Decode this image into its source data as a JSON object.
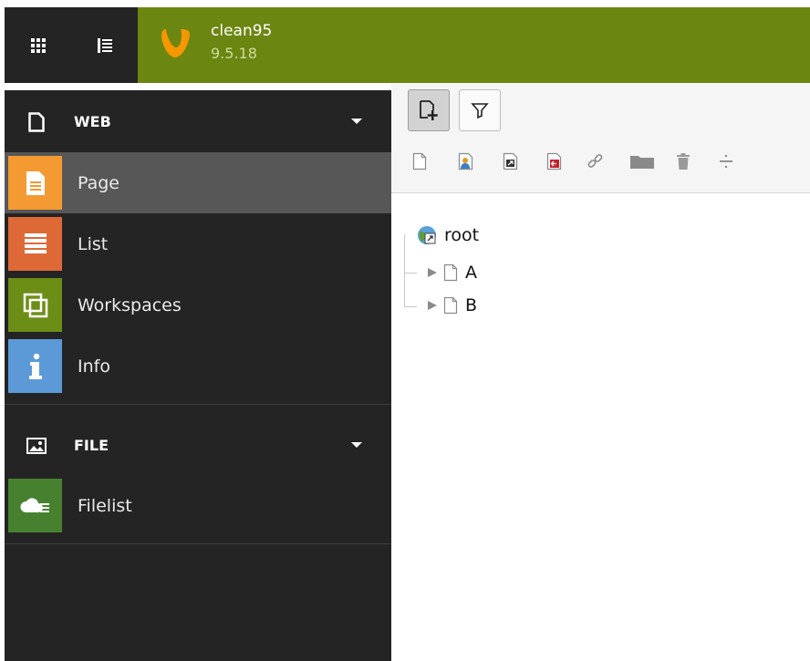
{
  "topbar": {
    "app_switcher_icon": "app-grid-icon",
    "tree_toggle_icon": "list-tree-icon",
    "site_name": "clean95",
    "version": "9.5.18",
    "brand_color": "#6b8611",
    "logo_color": "#f49700"
  },
  "sidebar": {
    "groups": [
      {
        "label": "WEB",
        "icon": "document-icon",
        "items": [
          {
            "label": "Page",
            "icon": "page-module-icon",
            "color": "#f49a33",
            "active": true
          },
          {
            "label": "List",
            "icon": "list-module-icon",
            "color": "#dd6a36",
            "active": false
          },
          {
            "label": "Workspaces",
            "icon": "workspaces-module-icon",
            "color": "#6d8e16",
            "active": false
          },
          {
            "label": "Info",
            "icon": "info-module-icon",
            "color": "#5b9ad6",
            "active": false
          }
        ]
      },
      {
        "label": "FILE",
        "icon": "image-icon",
        "items": [
          {
            "label": "Filelist",
            "icon": "filelist-module-icon",
            "color": "#47812f",
            "active": false
          }
        ]
      }
    ]
  },
  "toolbar": {
    "buttons": [
      {
        "icon": "new-page-icon",
        "active": true
      },
      {
        "icon": "filter-icon",
        "active": false
      }
    ],
    "drag_items": [
      {
        "icon": "page-default-icon"
      },
      {
        "icon": "page-backend-user-icon"
      },
      {
        "icon": "page-shortcut-icon"
      },
      {
        "icon": "page-external-link-icon"
      },
      {
        "icon": "page-link-icon"
      },
      {
        "icon": "folder-icon"
      },
      {
        "icon": "recycler-icon"
      },
      {
        "icon": "menu-separator-icon"
      }
    ]
  },
  "tree": {
    "root": {
      "label": "root",
      "icon": "globe-site-icon"
    },
    "children": [
      {
        "label": "A",
        "icon": "page-icon"
      },
      {
        "label": "B",
        "icon": "page-icon"
      }
    ]
  }
}
